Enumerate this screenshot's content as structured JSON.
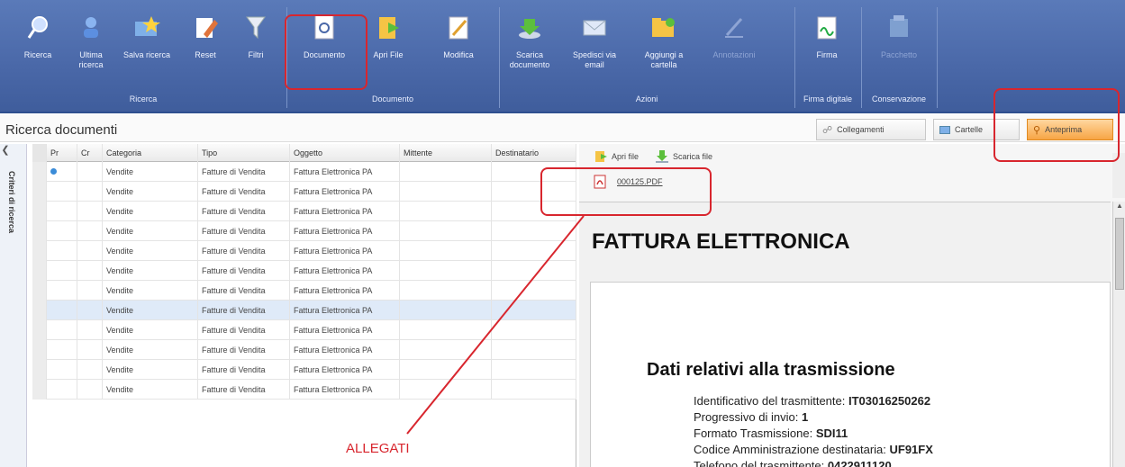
{
  "ribbon": {
    "buttons": [
      {
        "label": "Ricerca",
        "icon": "search-icon"
      },
      {
        "label": "Ultima ricerca",
        "icon": "user-search-icon"
      },
      {
        "label": "Salva ricerca",
        "icon": "save-search-icon"
      },
      {
        "label": "Reset",
        "icon": "eraser-icon"
      },
      {
        "label": "Filtri",
        "icon": "filter-icon"
      },
      {
        "label": "Documento",
        "icon": "document-search-icon"
      },
      {
        "label": "Apri File",
        "icon": "open-file-icon"
      },
      {
        "label": "Modifica",
        "icon": "edit-icon"
      },
      {
        "label": "Scarica documento",
        "icon": "download-icon"
      },
      {
        "label": "Spedisci via email",
        "icon": "email-icon"
      },
      {
        "label": "Aggiungi a cartella",
        "icon": "add-folder-icon"
      },
      {
        "label": "Annotazioni",
        "icon": "annotation-icon"
      },
      {
        "label": "Firma",
        "icon": "signature-icon"
      },
      {
        "label": "Pacchetto",
        "icon": "package-icon"
      }
    ],
    "groups": {
      "ricerca": "Ricerca",
      "documento": "Documento",
      "azioni": "Azioni",
      "firma_digitale": "Firma digitale",
      "conservazione": "Conservazione"
    }
  },
  "titlebar": {
    "title": "Ricerca documenti",
    "collegamenti": "Collegamenti",
    "cartelle": "Cartelle",
    "anteprima": "Anteprima"
  },
  "criteri": {
    "label": "Criteri di ricerca"
  },
  "grid": {
    "columns": [
      "Pr",
      "Cr",
      "Categoria",
      "Tipo",
      "Oggetto",
      "Mittente",
      "Destinatario"
    ],
    "rows": [
      {
        "categoria": "Vendite",
        "tipo": "Fatture di Vendita",
        "oggetto": "Fattura Elettronica PA"
      },
      {
        "categoria": "Vendite",
        "tipo": "Fatture di Vendita",
        "oggetto": "Fattura Elettronica PA"
      },
      {
        "categoria": "Vendite",
        "tipo": "Fatture di Vendita",
        "oggetto": "Fattura Elettronica PA"
      },
      {
        "categoria": "Vendite",
        "tipo": "Fatture di Vendita",
        "oggetto": "Fattura Elettronica PA"
      },
      {
        "categoria": "Vendite",
        "tipo": "Fatture di Vendita",
        "oggetto": "Fattura Elettronica PA"
      },
      {
        "categoria": "Vendite",
        "tipo": "Fatture di Vendita",
        "oggetto": "Fattura Elettronica PA"
      },
      {
        "categoria": "Vendite",
        "tipo": "Fatture di Vendita",
        "oggetto": "Fattura Elettronica PA"
      },
      {
        "categoria": "Vendite",
        "tipo": "Fatture di Vendita",
        "oggetto": "Fattura Elettronica PA"
      },
      {
        "categoria": "Vendite",
        "tipo": "Fatture di Vendita",
        "oggetto": "Fattura Elettronica PA"
      },
      {
        "categoria": "Vendite",
        "tipo": "Fatture di Vendita",
        "oggetto": "Fattura Elettronica PA"
      },
      {
        "categoria": "Vendite",
        "tipo": "Fatture di Vendita",
        "oggetto": "Fattura Elettronica PA"
      },
      {
        "categoria": "Vendite",
        "tipo": "Fatture di Vendita",
        "oggetto": "Fattura Elettronica PA"
      }
    ]
  },
  "preview": {
    "apri_file": "Apri file",
    "scarica_file": "Scarica file",
    "attachment": "000125.PDF",
    "pdf_title": "FATTURA ELETTRONICA",
    "section_title": "Dati relativi alla trasmissione",
    "lines": [
      {
        "label": "Identificativo del trasmittente: ",
        "value": "IT03016250262"
      },
      {
        "label": "Progressivo di invio: ",
        "value": "1"
      },
      {
        "label": "Formato Trasmissione: ",
        "value": "SDI11"
      },
      {
        "label": "Codice Amministrazione destinataria: ",
        "value": "UF91FX"
      },
      {
        "label": "Telefono del trasmittente: ",
        "value": "0422911120"
      }
    ]
  },
  "annotation": {
    "label": "ALLEGATI",
    "color": "#d8262e"
  },
  "colors": {
    "ribbon": "#4a68a8",
    "accent": "#f7a545",
    "selected_row": "#dfeaf8"
  }
}
